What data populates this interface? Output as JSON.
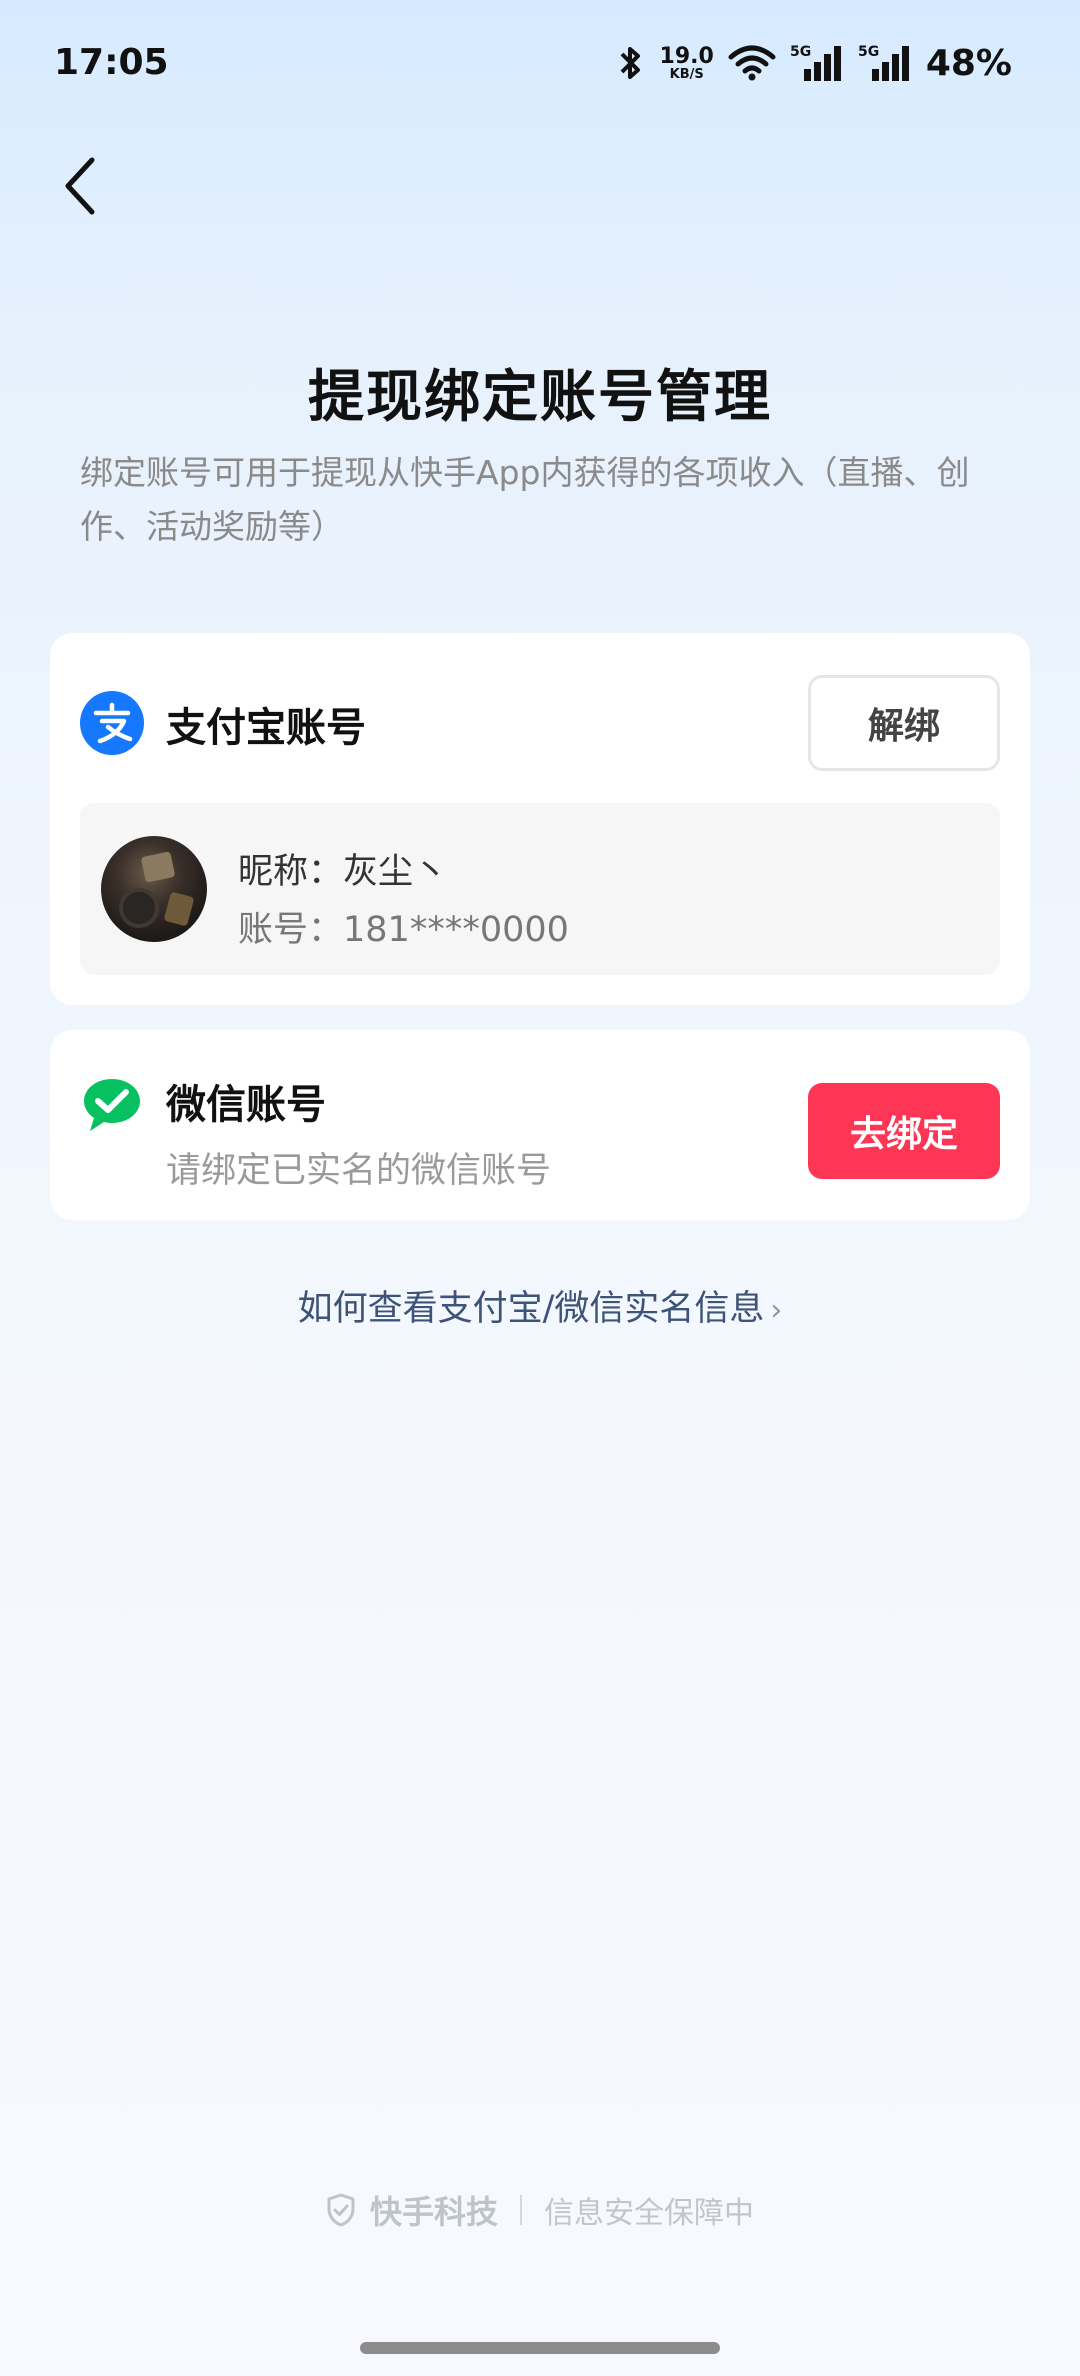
{
  "status_bar": {
    "time": "17:05",
    "net_speed_value": "19.0",
    "net_speed_unit": "KB/S",
    "battery": "48%",
    "icons": [
      "bluetooth-icon",
      "wifi-icon",
      "signal-5g-icon",
      "signal-5g-icon"
    ]
  },
  "header": {
    "back_icon": "chevron-left-icon",
    "title": "提现绑定账号管理",
    "description": "绑定账号可用于提现从快手App内获得的各项收入（直播、创作、活动奖励等）"
  },
  "alipay": {
    "icon": "alipay-icon",
    "title": "支付宝账号",
    "unbind_label": "解绑",
    "nickname_label": "昵称：",
    "nickname": "灰尘丶",
    "account_label": "账号：",
    "account": "181****0000"
  },
  "wechat": {
    "icon": "wechat-icon",
    "title": "微信账号",
    "subtitle": "请绑定已实名的微信账号",
    "bind_label": "去绑定"
  },
  "help_link": {
    "label": "如何查看支付宝/微信实名信息",
    "chevron": "›"
  },
  "footer": {
    "shield_icon": "shield-check-icon",
    "brand": "快手科技",
    "slogan": "信息安全保障中"
  },
  "colors": {
    "accent_red": "#fe3655",
    "alipay_blue": "#1677ff",
    "wechat_green": "#07c160",
    "link": "#3d5377"
  }
}
